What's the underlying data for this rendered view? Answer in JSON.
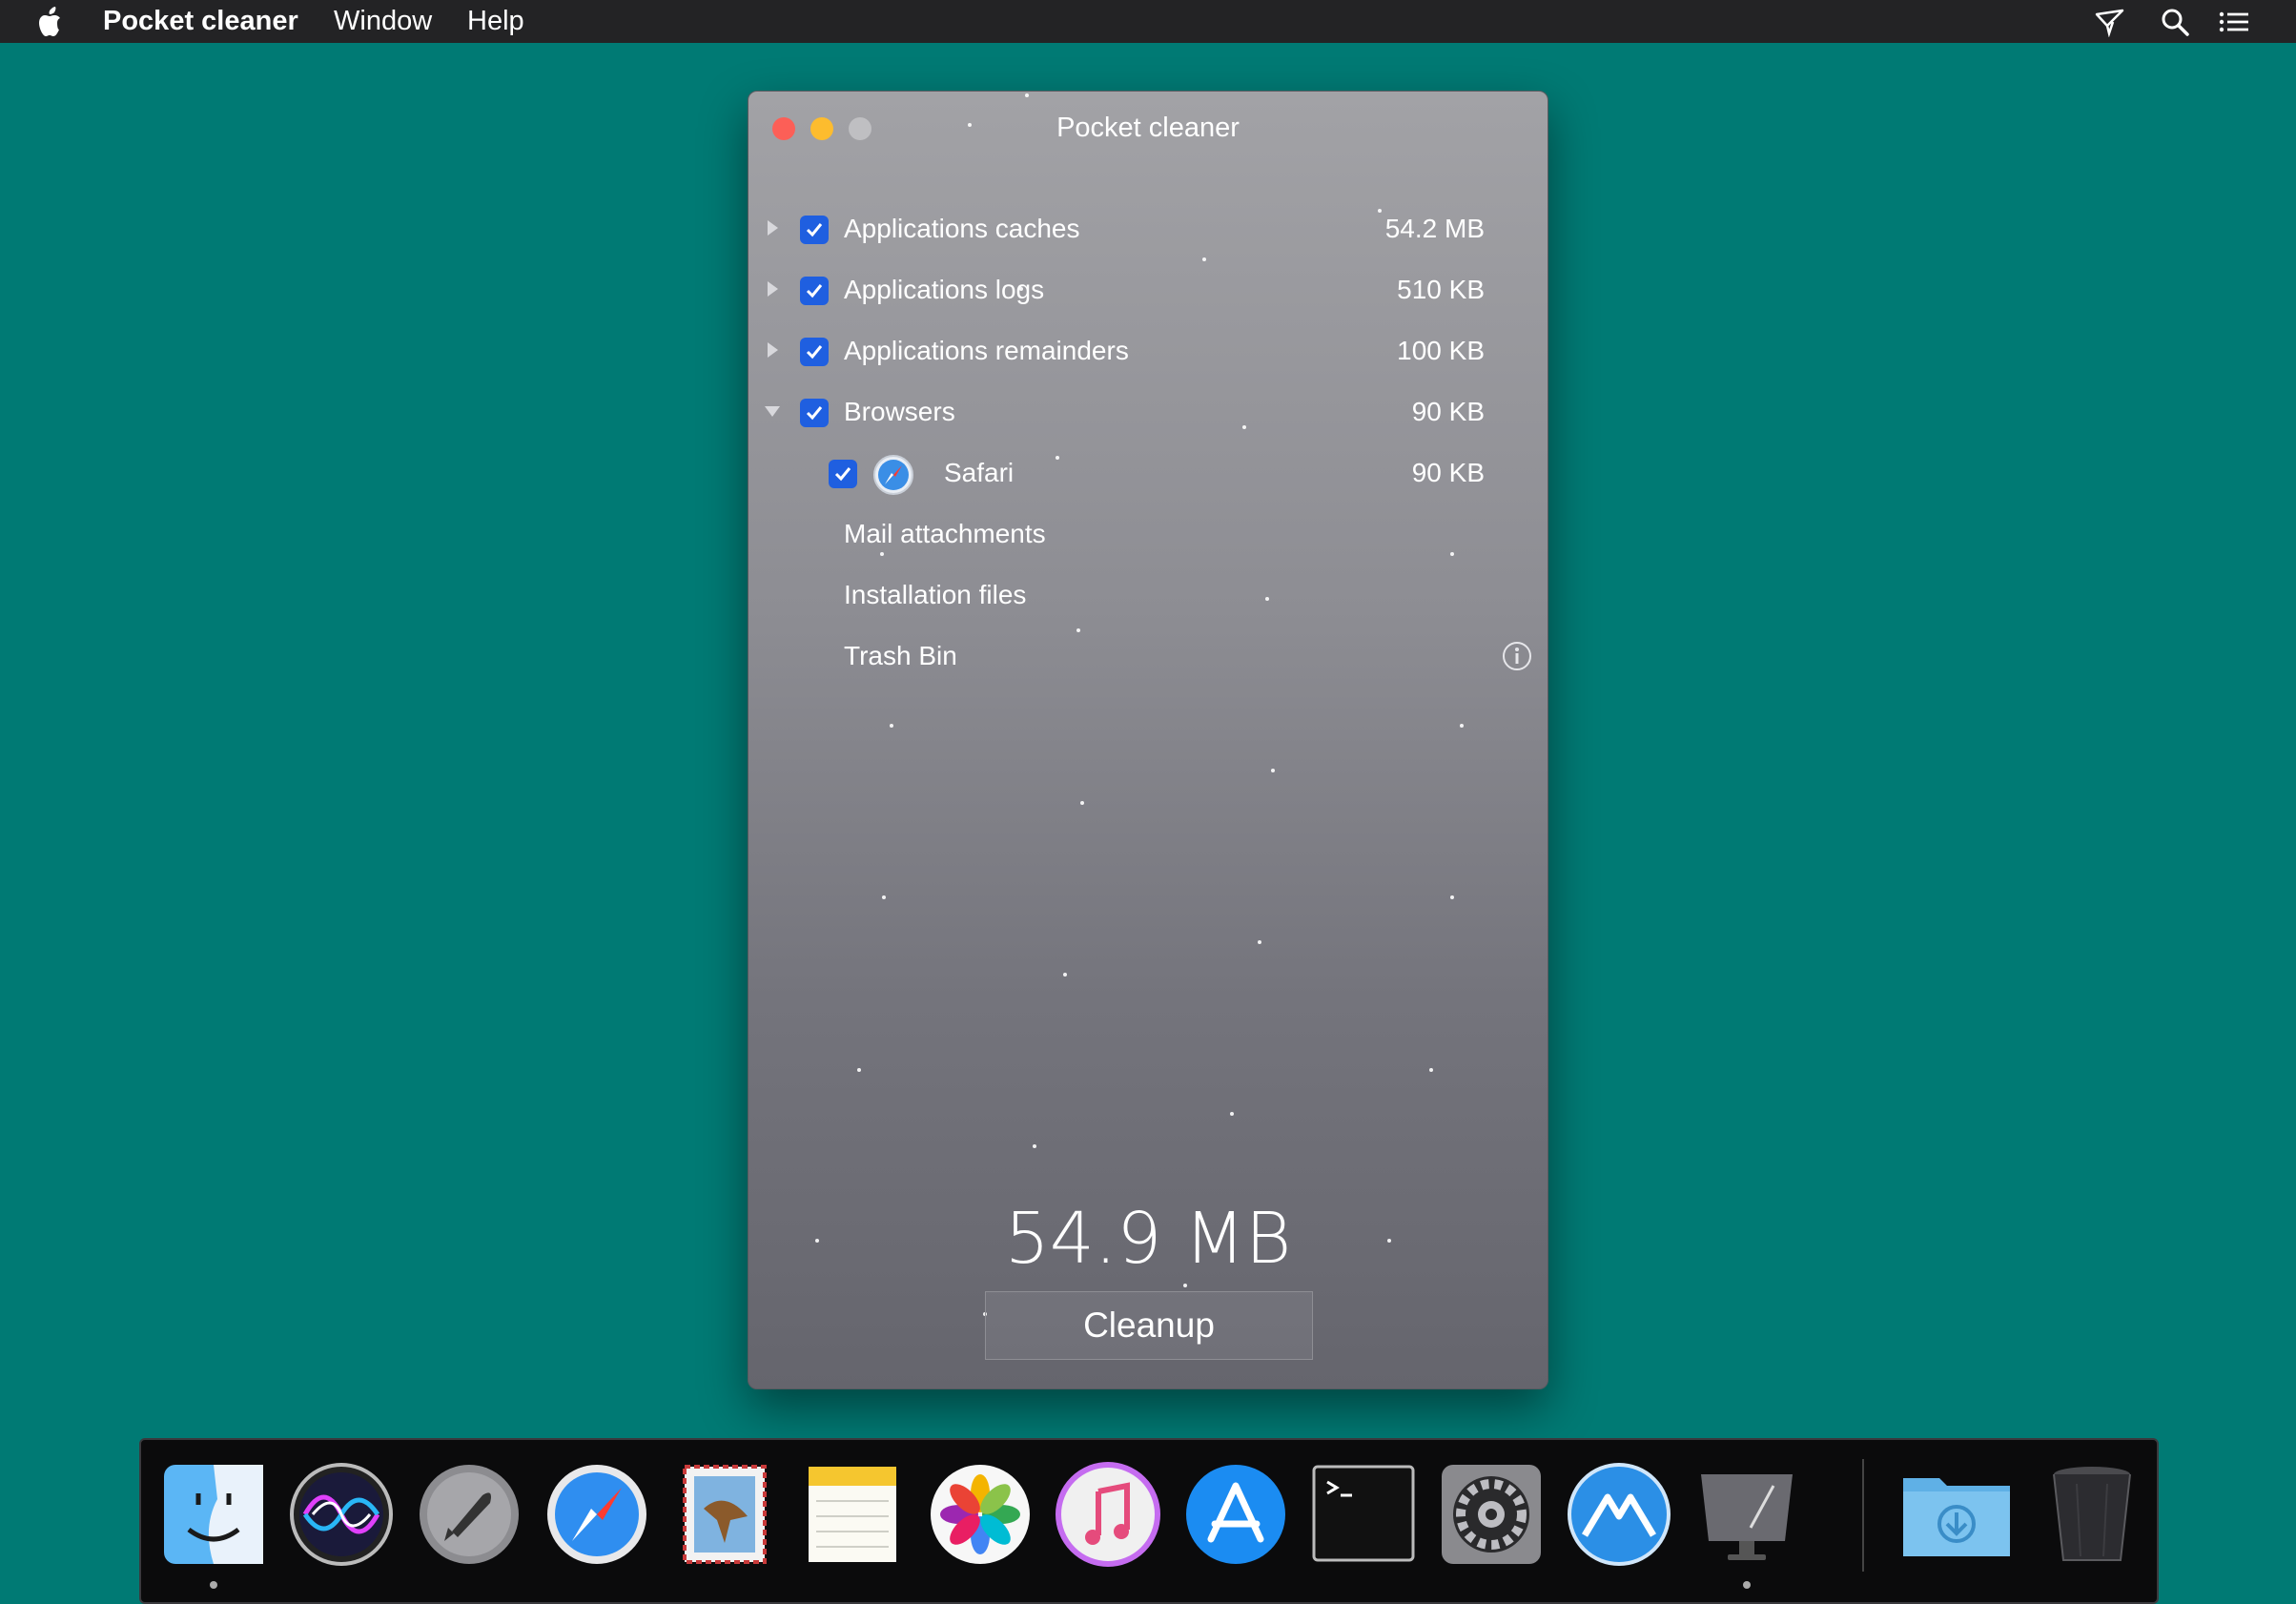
{
  "menubar": {
    "app_name": "Pocket cleaner",
    "items": [
      "Window",
      "Help"
    ],
    "right_icons": [
      "airplane-send-icon",
      "search-icon",
      "list-icon"
    ]
  },
  "window": {
    "title": "Pocket cleaner",
    "rows": [
      {
        "label": "Applications caches",
        "size": "54.2 MB",
        "checked": true,
        "disclosure": "collapsed"
      },
      {
        "label": "Applications logs",
        "size": "510 KB",
        "checked": true,
        "disclosure": "collapsed"
      },
      {
        "label": "Applications remainders",
        "size": "100 KB",
        "checked": true,
        "disclosure": "collapsed"
      },
      {
        "label": "Browsers",
        "size": "90 KB",
        "checked": true,
        "disclosure": "expanded"
      },
      {
        "label": "Safari",
        "size": "90 KB",
        "checked": true,
        "icon": "safari-icon"
      },
      {
        "label": "Mail attachments"
      },
      {
        "label": "Installation files"
      },
      {
        "label": "Trash Bin",
        "icon": "info-icon"
      }
    ],
    "total": "54.9 MB",
    "cleanup_label": "Cleanup"
  },
  "colors": {
    "desktop": "#007a74",
    "checkbox": "#1f5fe0",
    "close": "#fc5f57",
    "minimize": "#fdbc2e"
  },
  "dock": {
    "apps": [
      "finder-icon",
      "siri-icon",
      "launchpad-icon",
      "safari-icon",
      "mail-icon",
      "notes-icon",
      "photos-icon",
      "itunes-icon",
      "app-store-icon",
      "terminal-icon",
      "system-preferences-icon",
      "pocket-cleaner-icon",
      "display-icon",
      "downloads-folder-icon",
      "trash-icon"
    ]
  }
}
